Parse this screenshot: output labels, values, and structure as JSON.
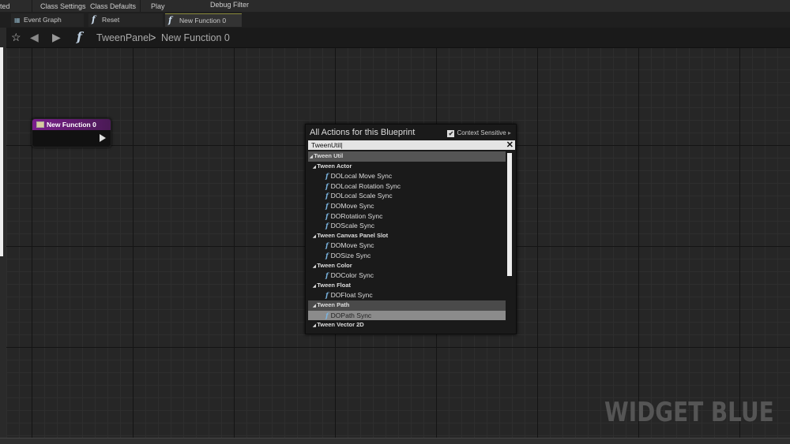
{
  "toolbar": {
    "items": [
      "ted",
      "Class Settings",
      "Class Defaults",
      "Play",
      "Debug Filter"
    ]
  },
  "tabs": [
    {
      "label": "Event Graph",
      "icon": "event-graph-icon"
    },
    {
      "label": "Reset",
      "icon": "function-icon"
    },
    {
      "label": "New Function 0",
      "icon": "function-icon",
      "active": true
    }
  ],
  "breadcrumb": {
    "parent": "TweenPanel",
    "separator": ">",
    "current": "New Function 0"
  },
  "node": {
    "title": "New Function 0",
    "color": "#7a1f8c"
  },
  "actions_menu": {
    "title": "All Actions for this Blueprint",
    "context_sensitive_label": "Context Sensitive",
    "context_sensitive": true,
    "search_value": "TweenUtil",
    "items": [
      {
        "type": "top",
        "label": "Tween Util"
      },
      {
        "type": "cat",
        "label": "Tween Actor"
      },
      {
        "type": "fn",
        "label": "DOLocal Move Sync"
      },
      {
        "type": "fn",
        "label": "DOLocal Rotation Sync"
      },
      {
        "type": "fn",
        "label": "DOLocal Scale Sync"
      },
      {
        "type": "fn",
        "label": "DOMove Sync"
      },
      {
        "type": "fn",
        "label": "DORotation Sync"
      },
      {
        "type": "fn",
        "label": "DOScale Sync"
      },
      {
        "type": "cat",
        "label": "Tween Canvas Panel Slot"
      },
      {
        "type": "fn",
        "label": "DOMove Sync"
      },
      {
        "type": "fn",
        "label": "DOSize Sync"
      },
      {
        "type": "cat",
        "label": "Tween Color"
      },
      {
        "type": "fn",
        "label": "DOColor Sync"
      },
      {
        "type": "cat",
        "label": "Tween Float"
      },
      {
        "type": "fn",
        "label": "DOFloat Sync"
      },
      {
        "type": "cat",
        "label": "Tween Path",
        "state": "hover"
      },
      {
        "type": "fn",
        "label": "DOPath Sync",
        "state": "selected"
      },
      {
        "type": "cat",
        "label": "Tween Vector 2D"
      }
    ]
  },
  "watermark": "WIDGET BLUE"
}
